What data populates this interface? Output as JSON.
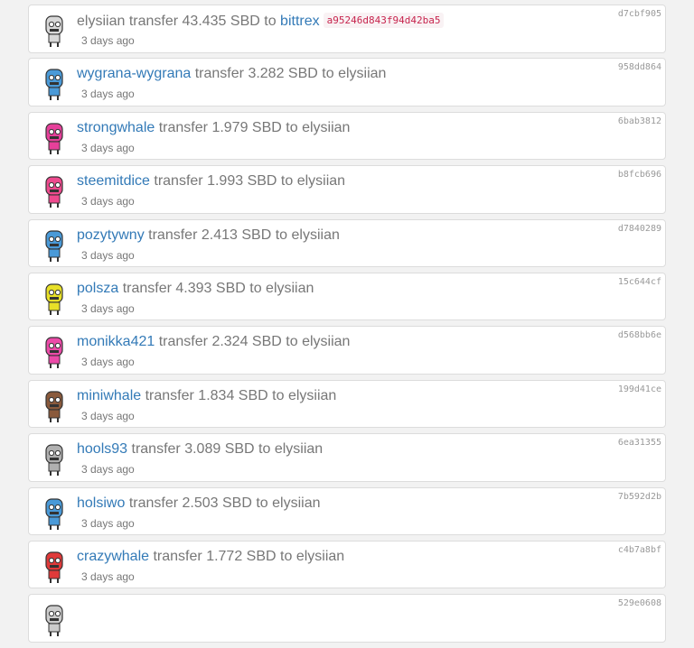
{
  "transfers": [
    {
      "from": "elysiian",
      "from_is_link": false,
      "verb": "transfer",
      "amount": "43.435 SBD",
      "to_word": "to",
      "to": "bittrex",
      "to_is_link": true,
      "memo": "a95246d843f94d42ba5",
      "time": "3 days ago",
      "hash": "d7cbf905",
      "robot_color": "#d8d8d8"
    },
    {
      "from": "wygrana-wygrana",
      "from_is_link": true,
      "verb": "transfer",
      "amount": "3.282 SBD",
      "to_word": "to",
      "to": "elysiian",
      "to_is_link": false,
      "memo": "",
      "time": "3 days ago",
      "hash": "958dd864",
      "robot_color": "#4a9ad8"
    },
    {
      "from": "strongwhale",
      "from_is_link": true,
      "verb": "transfer",
      "amount": "1.979 SBD",
      "to_word": "to",
      "to": "elysiian",
      "to_is_link": false,
      "memo": "",
      "time": "3 days ago",
      "hash": "6bab3812",
      "robot_color": "#e6409a"
    },
    {
      "from": "steemitdice",
      "from_is_link": true,
      "verb": "transfer",
      "amount": "1.993 SBD",
      "to_word": "to",
      "to": "elysiian",
      "to_is_link": false,
      "memo": "",
      "time": "3 days ago",
      "hash": "b8fcb696",
      "robot_color": "#ee4a8e"
    },
    {
      "from": "pozytywny",
      "from_is_link": true,
      "verb": "transfer",
      "amount": "2.413 SBD",
      "to_word": "to",
      "to": "elysiian",
      "to_is_link": false,
      "memo": "",
      "time": "3 days ago",
      "hash": "d7840289",
      "robot_color": "#4a9ad8"
    },
    {
      "from": "polsza",
      "from_is_link": true,
      "verb": "transfer",
      "amount": "4.393 SBD",
      "to_word": "to",
      "to": "elysiian",
      "to_is_link": false,
      "memo": "",
      "time": "3 days ago",
      "hash": "15c644cf",
      "robot_color": "#e8e028"
    },
    {
      "from": "monikka421",
      "from_is_link": true,
      "verb": "transfer",
      "amount": "2.324 SBD",
      "to_word": "to",
      "to": "elysiian",
      "to_is_link": false,
      "memo": "",
      "time": "3 days ago",
      "hash": "d568bb6e",
      "robot_color": "#ec4aa8"
    },
    {
      "from": "miniwhale",
      "from_is_link": true,
      "verb": "transfer",
      "amount": "1.834 SBD",
      "to_word": "to",
      "to": "elysiian",
      "to_is_link": false,
      "memo": "",
      "time": "3 days ago",
      "hash": "199d41ce",
      "robot_color": "#8a5a3c"
    },
    {
      "from": "hools93",
      "from_is_link": true,
      "verb": "transfer",
      "amount": "3.089 SBD",
      "to_word": "to",
      "to": "elysiian",
      "to_is_link": false,
      "memo": "",
      "time": "3 days ago",
      "hash": "6ea31355",
      "robot_color": "#b0b0b0"
    },
    {
      "from": "holsiwo",
      "from_is_link": true,
      "verb": "transfer",
      "amount": "2.503 SBD",
      "to_word": "to",
      "to": "elysiian",
      "to_is_link": false,
      "memo": "",
      "time": "3 days ago",
      "hash": "7b592d2b",
      "robot_color": "#4a9ad8"
    },
    {
      "from": "crazywhale",
      "from_is_link": true,
      "verb": "transfer",
      "amount": "1.772 SBD",
      "to_word": "to",
      "to": "elysiian",
      "to_is_link": false,
      "memo": "",
      "time": "3 days ago",
      "hash": "c4b7a8bf",
      "robot_color": "#e03a3a"
    },
    {
      "from": "",
      "from_is_link": true,
      "verb": "",
      "amount": "",
      "to_word": "",
      "to": "",
      "to_is_link": false,
      "memo": "",
      "time": "",
      "hash": "529e0608",
      "robot_color": "#cccccc"
    }
  ]
}
